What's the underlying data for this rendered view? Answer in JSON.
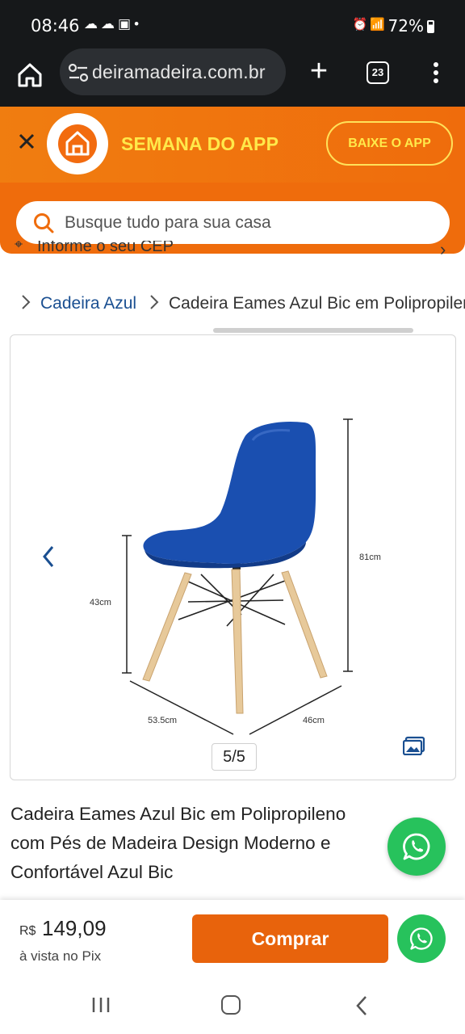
{
  "status_bar": {
    "time": "08:46",
    "left_icons": [
      "cloud-icon",
      "cloud-icon",
      "image-icon",
      "dot-icon"
    ],
    "right_icons": [
      "alarm-icon",
      "wifi-icon",
      "signal-icon",
      "volte-icon",
      "signal-icon"
    ],
    "battery": "72%"
  },
  "browser": {
    "url": "deiramadeira.com.br",
    "tab_count": "23"
  },
  "app_banner": {
    "title": "SEMANA DO APP",
    "cta": "BAIXE O APP"
  },
  "search": {
    "placeholder": "Busque tudo para sua casa"
  },
  "cep": {
    "label": "Informe o seu CEP"
  },
  "breadcrumb": {
    "items": [
      "Cadeira Azul",
      "Cadeira Eames Azul Bic em Polipropileno com Pés de Madeira"
    ]
  },
  "gallery": {
    "counter": "5/5",
    "dimensions": {
      "seat_height": "43cm",
      "total_height": "81cm",
      "width": "53.5cm",
      "depth": "46cm"
    },
    "chair_color": "#1a4fb0",
    "leg_color": "#e7c99a"
  },
  "product": {
    "title": "Cadeira Eames Azul Bic em Polipropileno com Pés de Madeira Design Moderno e Confortável Azul Bic"
  },
  "purchase": {
    "currency": "R$",
    "price": "149,09",
    "note": "à vista no Pix",
    "buy_label": "Comprar"
  },
  "colors": {
    "brand_orange": "#ef6c0c",
    "banner_yellow": "#ffe94a",
    "whatsapp_green": "#27c25c",
    "link_blue": "#1a4f91"
  }
}
